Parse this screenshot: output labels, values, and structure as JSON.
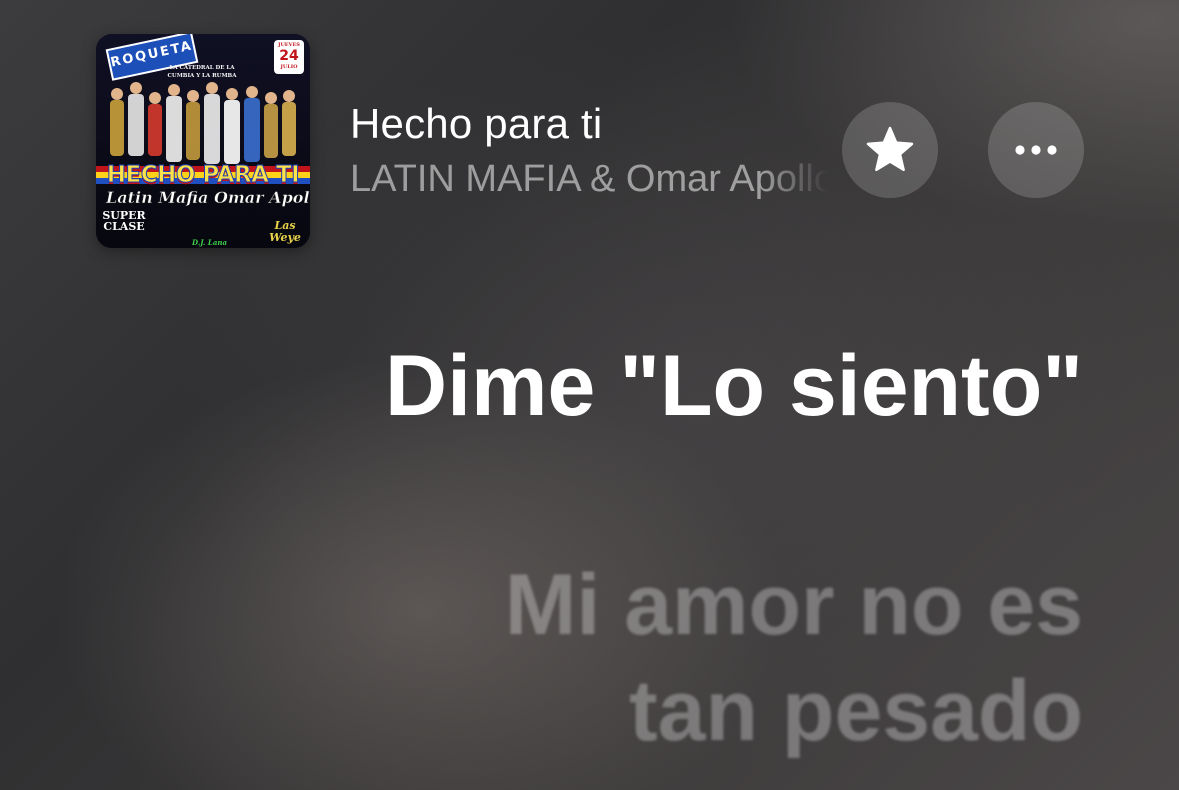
{
  "now_playing": {
    "title": "Hecho para ti",
    "artist": "LATIN MAFIA & Omar Apollo",
    "artwork": {
      "badge": "ROQUETA",
      "tagline": "LA CATEDRAL DE LA CUMBIA Y LA RUMBA",
      "date_day": "JUEVES",
      "date_num": "24",
      "date_month": "JULIO",
      "poster_title": "HECHO PARA TI",
      "poster_artists": "Latin Mafia Omar Apollo",
      "super_clase": "SUPER CLASE",
      "las_weye": "Las Weye",
      "dj": "D.J. Lana"
    }
  },
  "controls": {
    "favorite_icon": "star-icon",
    "more_icon": "ellipsis-icon"
  },
  "lyrics": {
    "active": "Dime \"Lo siento\"",
    "next": [
      "Mi amor no es",
      "tan pesado"
    ]
  },
  "colors": {
    "active_lyric": "#ffffff",
    "inactive_lyric": "rgba(255,255,255,0.3)",
    "button_bg": "rgba(255,255,255,0.17)"
  }
}
